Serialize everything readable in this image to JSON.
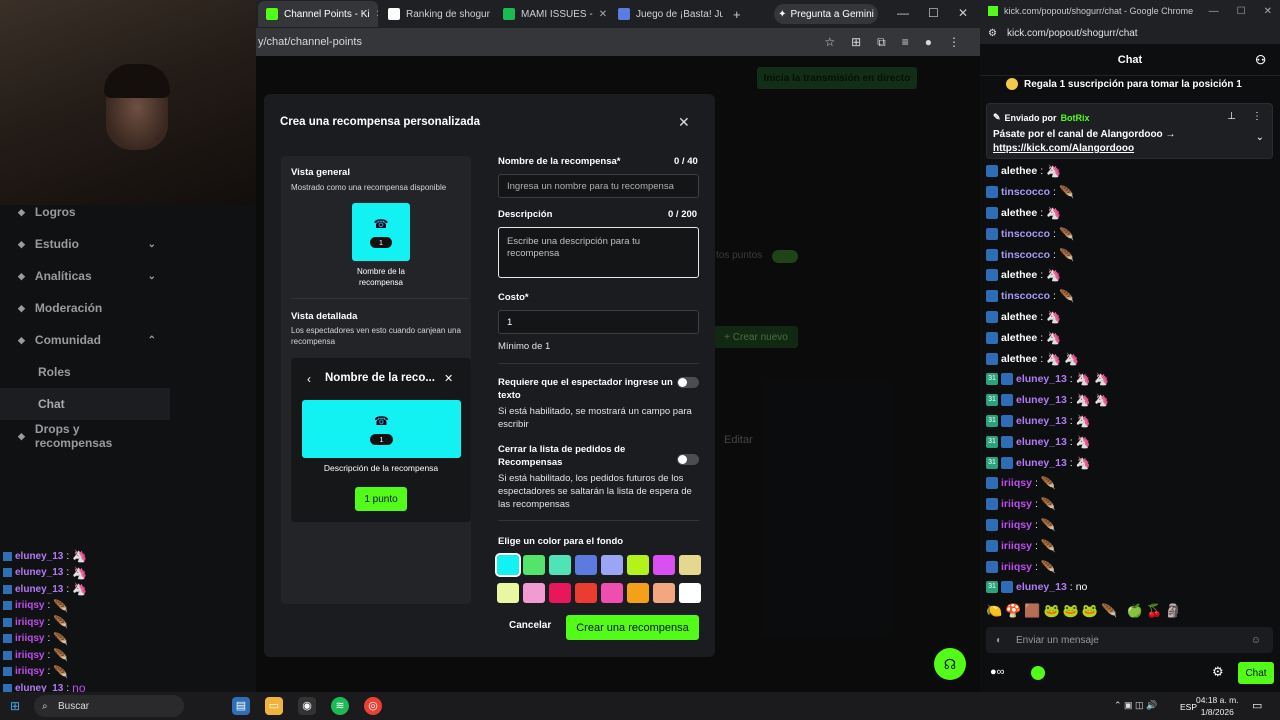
{
  "left_browser": {
    "tabs": [
      {
        "label": "Channel Points - Ki",
        "favicon_color": "#53fc18",
        "active": true
      },
      {
        "label": "Ranking de shogur",
        "favicon_color": "#ffffff"
      },
      {
        "label": "MAMI ISSUES - ",
        "favicon_color": "#1db954"
      },
      {
        "label": "Juego de ¡Basta! Ju",
        "favicon_color": "#5b7be0"
      }
    ],
    "new_tab": "+",
    "gemini_button": "Pregunta a Gemini",
    "url": "y/chat/channel-points"
  },
  "page": {
    "start_stream": "Inicia la transmisión en directo",
    "sidebar": [
      {
        "label": "Logros",
        "chev": ""
      },
      {
        "label": "Estudio",
        "chev": "⌄"
      },
      {
        "label": "Analíticas",
        "chev": "⌄"
      },
      {
        "label": "Moderación",
        "chev": ""
      },
      {
        "label": "Comunidad",
        "chev": "⌃"
      },
      {
        "label": "Roles",
        "chev": ""
      },
      {
        "label": "Chat",
        "chev": ""
      },
      {
        "label": "Drops y recompensas",
        "chev": ""
      }
    ],
    "bg_points_label": "tos puntos",
    "bg_new": "+ Crear nuevo",
    "bg_edit": "Editar"
  },
  "modal": {
    "title": "Crea una recompensa personalizada",
    "close": "✕",
    "overview_title": "Vista general",
    "overview_sub": "Mostrado como una recompensa disponible",
    "tile_cost": "1",
    "tile_name": "Nombre de la recompensa",
    "detail_title": "Vista detallada",
    "detail_sub": "Los espectadores ven esto cuando canjean una recompensa",
    "detail_header": "Nombre de la reco...",
    "detail_desc": "Descripción de la recompensa",
    "detail_button": "1 punto",
    "name_label": "Nombre de la recompensa*",
    "name_count": "0 / 40",
    "name_placeholder": "Ingresa un nombre para tu recompensa",
    "desc_label": "Descripción",
    "desc_count": "0 / 200",
    "desc_placeholder": "Escribe una descripción para tu recompensa",
    "cost_label": "Costo*",
    "cost_value": "1",
    "cost_min": "Mínimo de 1",
    "require_label": "Requiere que el espectador ingrese un texto",
    "require_hint": "Si está habilitado, se mostrará un campo para escribir",
    "close_queue_label": "Cerrar la lista de pedidos de Recompensas",
    "close_queue_hint": "Si está habilitado, los pedidos futuros de los espectadores se saltarán la lista de espera de las recompensas",
    "color_label": "Elige un color para el fondo",
    "colors_row1": [
      "#13f2f2",
      "#53e56b",
      "#4fe3b5",
      "#5b7be0",
      "#9aa6f5",
      "#b4f21c",
      "#d84ff2",
      "#e5d88e"
    ],
    "colors_row2": [
      "#e8f7a0",
      "#f29ad2",
      "#e8165a",
      "#ec3b2f",
      "#f04db0",
      "#f4a019",
      "#f3a781",
      "#ffffff"
    ],
    "selected_color": "#13f2f2",
    "cancel": "Cancelar",
    "create": "Crear una recompensa"
  },
  "left_chat": [
    {
      "name": "eluney_13",
      "color": "#b27bf5",
      "emote": "🦄"
    },
    {
      "name": "eluney_13",
      "color": "#b27bf5",
      "emote": "🦄"
    },
    {
      "name": "eluney_13",
      "color": "#b27bf5",
      "emote": "🦄"
    },
    {
      "name": "iriiqsy",
      "color": "#c04bf0",
      "emote": "🪶"
    },
    {
      "name": "iriiqsy",
      "color": "#c04bf0",
      "emote": "🪶"
    },
    {
      "name": "iriiqsy",
      "color": "#c04bf0",
      "emote": "🪶"
    },
    {
      "name": "iriiqsy",
      "color": "#c04bf0",
      "emote": "🪶"
    },
    {
      "name": "iriiqsy",
      "color": "#c04bf0",
      "emote": "🪶"
    },
    {
      "name": "eluney_13",
      "color": "#b27bf5",
      "emote": "no"
    }
  ],
  "right_browser": {
    "title": "kick.com/popout/shogurr/chat - Google Chrome",
    "url": "kick.com/popout/shogurr/chat",
    "header": "Chat",
    "gift": "Regala 1 suscripción para tomar la posición 1",
    "pinned_by": "Enviado por",
    "pinned_user": "BotRix",
    "pinned_text": "Pásate por el canal de Alangordooo →",
    "pinned_link": "https://kick.com/Alangordooo",
    "messages": [
      {
        "name": "alethee",
        "color": "#ffffff",
        "sub": false,
        "emote": "🦄"
      },
      {
        "name": "tinscocco",
        "color": "#a69af5",
        "sub": false,
        "emote": "🪶"
      },
      {
        "name": "alethee",
        "color": "#ffffff",
        "sub": false,
        "emote": "🦄"
      },
      {
        "name": "tinscocco",
        "color": "#a69af5",
        "sub": false,
        "emote": "🪶"
      },
      {
        "name": "tinscocco",
        "color": "#a69af5",
        "sub": false,
        "emote": "🪶"
      },
      {
        "name": "alethee",
        "color": "#ffffff",
        "sub": false,
        "emote": "🦄"
      },
      {
        "name": "tinscocco",
        "color": "#a69af5",
        "sub": false,
        "emote": "🪶"
      },
      {
        "name": "alethee",
        "color": "#ffffff",
        "sub": false,
        "emote": "🦄"
      },
      {
        "name": "alethee",
        "color": "#ffffff",
        "sub": false,
        "emote": "🦄"
      },
      {
        "name": "alethee",
        "color": "#ffffff",
        "sub": false,
        "emote": "🦄 🦄"
      },
      {
        "name": "eluney_13",
        "color": "#b27bf5",
        "sub": true,
        "emote": "🦄 🦄"
      },
      {
        "name": "eluney_13",
        "color": "#b27bf5",
        "sub": true,
        "emote": "🦄 🦄"
      },
      {
        "name": "eluney_13",
        "color": "#b27bf5",
        "sub": true,
        "emote": "🦄"
      },
      {
        "name": "eluney_13",
        "color": "#b27bf5",
        "sub": true,
        "emote": "🦄"
      },
      {
        "name": "eluney_13",
        "color": "#b27bf5",
        "sub": true,
        "emote": "🦄"
      },
      {
        "name": "iriiqsy",
        "color": "#c04bf0",
        "sub": false,
        "emote": "🪶"
      },
      {
        "name": "iriiqsy",
        "color": "#c04bf0",
        "sub": false,
        "emote": "🪶"
      },
      {
        "name": "iriiqsy",
        "color": "#c04bf0",
        "sub": false,
        "emote": "🪶"
      },
      {
        "name": "iriiqsy",
        "color": "#c04bf0",
        "sub": false,
        "emote": "🪶"
      },
      {
        "name": "iriiqsy",
        "color": "#c04bf0",
        "sub": false,
        "emote": "🪶"
      },
      {
        "name": "eluney_13",
        "color": "#b27bf5",
        "sub": true,
        "emote": "no"
      }
    ],
    "emotes": "🍋🍄🟫🐸🐸🐸🪶 🍏🍒🗿",
    "input_placeholder": "Enviar un mensaje",
    "chat_button": "Chat"
  },
  "taskbar": {
    "search": "Buscar",
    "lang": "ESP",
    "time": "04:18 a. m.",
    "date": "1/8/2026"
  }
}
